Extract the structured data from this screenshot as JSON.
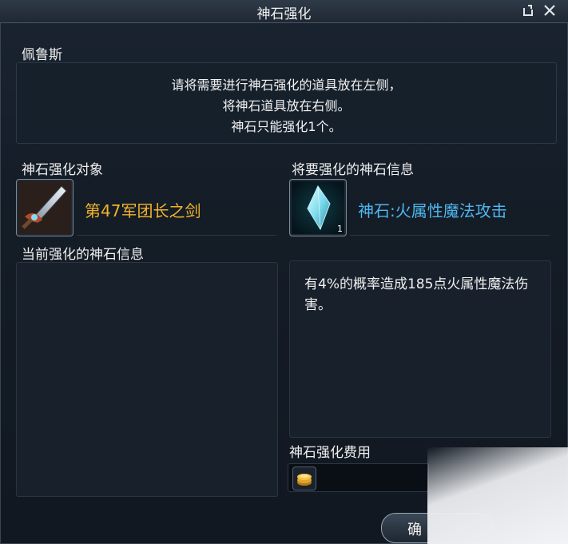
{
  "window": {
    "title": "神石强化"
  },
  "npc": {
    "name": "佩鲁斯"
  },
  "instructions": [
    "请将需要进行神石强化的道具放在左侧，",
    "将神石道具放在右侧。",
    "神石只能强化1个。"
  ],
  "left": {
    "target_label": "神石强化对象",
    "target_item_name": "第47军团长之剑",
    "current_info_label": "当前强化的神石信息"
  },
  "right": {
    "info_label": "将要强化的神石信息",
    "stone_name": "神石:火属性魔法攻击",
    "stone_count": "1",
    "description": "有4%的概率造成185点火属性魔法伤害。",
    "fee_label": "神石强化费用"
  },
  "buttons": {
    "confirm": "确"
  },
  "colors": {
    "target_item": "#f2b32a",
    "stone_name": "#4fb6f0"
  },
  "icons": {
    "restore": "restore-icon",
    "close": "close-icon",
    "sword": "sword-icon",
    "crystal": "crystal-icon",
    "coin": "gold-coin-icon"
  }
}
